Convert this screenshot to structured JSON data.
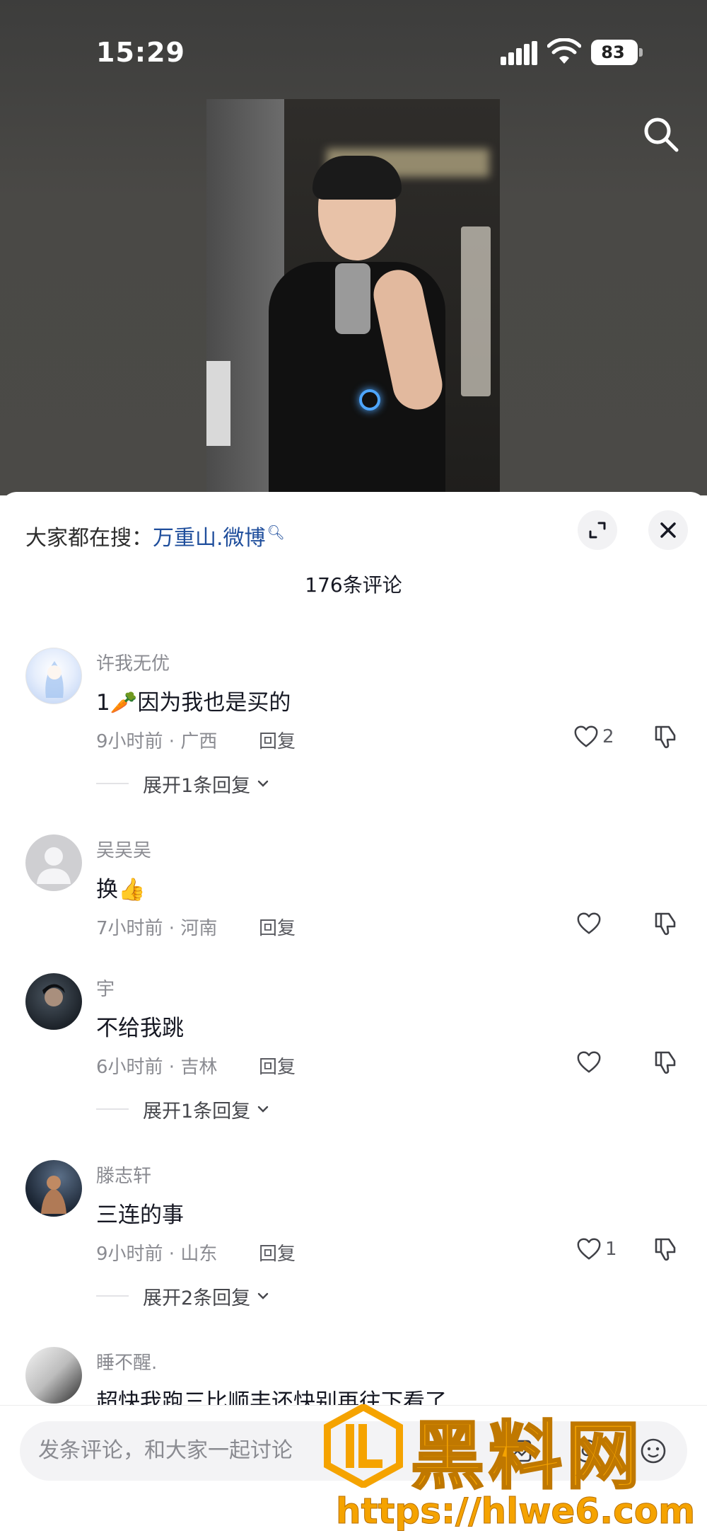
{
  "status_bar": {
    "time": "15:29",
    "battery": "83"
  },
  "hot_search": {
    "label": "大家都在搜：",
    "keyword": "万重山.微博"
  },
  "comment_count": "176条评论",
  "comments": [
    {
      "user": "许我无优",
      "text": "1🥕因为我也是买的",
      "meta": "9小时前 · 广西",
      "reply": "回复",
      "likes": "2",
      "expand": "展开1条回复"
    },
    {
      "user": "吴吴吴",
      "text": "换👍",
      "meta": "7小时前 · 河南",
      "reply": "回复",
      "likes": "",
      "expand": ""
    },
    {
      "user": "宇",
      "text": "不给我跳",
      "meta": "6小时前 · 吉林",
      "reply": "回复",
      "likes": "",
      "expand": "展开1条回复"
    },
    {
      "user": "滕志轩",
      "text": "三连的事",
      "meta": "9小时前 · 山东",
      "reply": "回复",
      "likes": "1",
      "expand": "展开2条回复"
    },
    {
      "user": "睡不醒.",
      "text": "超快我跑三比顺丰还快别再往下看了",
      "meta": "",
      "reply": "",
      "likes": "",
      "expand": ""
    }
  ],
  "composer": {
    "placeholder": "发条评论，和大家一起讨论"
  },
  "watermark": {
    "title": "黑料网",
    "url": "https://hlwe6.com"
  },
  "colors": {
    "accent_link": "#1f4e9c",
    "watermark": "#f5a300"
  }
}
